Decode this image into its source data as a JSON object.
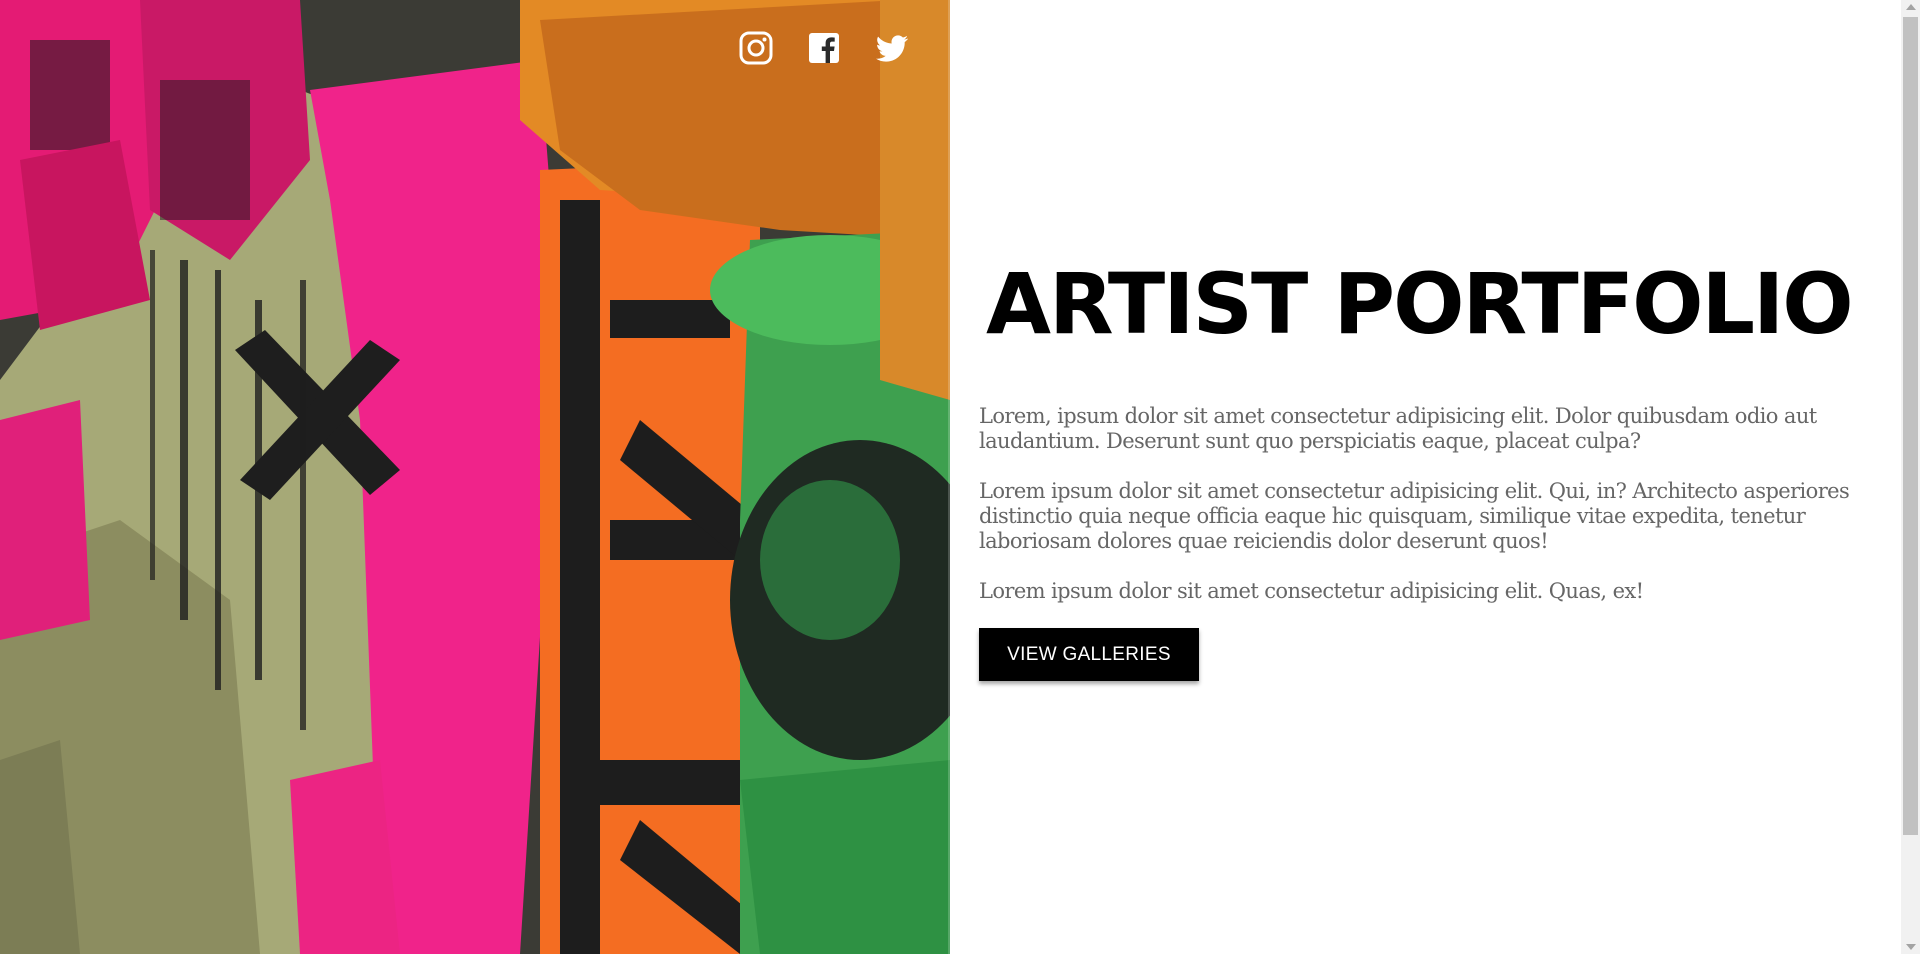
{
  "social": {
    "instagram_icon": "instagram-icon",
    "facebook_icon": "facebook-icon",
    "twitter_icon": "twitter-icon"
  },
  "main": {
    "title": "ARTIST PORTFOLIO",
    "paragraphs": [
      "Lorem, ipsum dolor sit amet consectetur adipisicing elit. Dolor quibusdam odio aut laudantium. Deserunt sunt quo perspiciatis eaque, placeat culpa?",
      "Lorem ipsum dolor sit amet consectetur adipisicing elit. Qui, in? Architecto asperiores distinctio quia neque officia eaque hic quisquam, similique vitae expedita, tenetur laboriosam dolores quae reiciendis dolor deserunt quos!",
      "Lorem ipsum dolor sit amet consectetur adipisicing elit. Quas, ex!"
    ],
    "cta_label": "VIEW GALLERIES"
  },
  "colors": {
    "title": "#000000",
    "body_text": "#666666",
    "button_bg": "#000000",
    "button_text": "#ffffff",
    "collage_pink": "#e91e77",
    "collage_orange": "#f26a21",
    "collage_green": "#3fa652",
    "collage_olive": "#a9ad78"
  }
}
